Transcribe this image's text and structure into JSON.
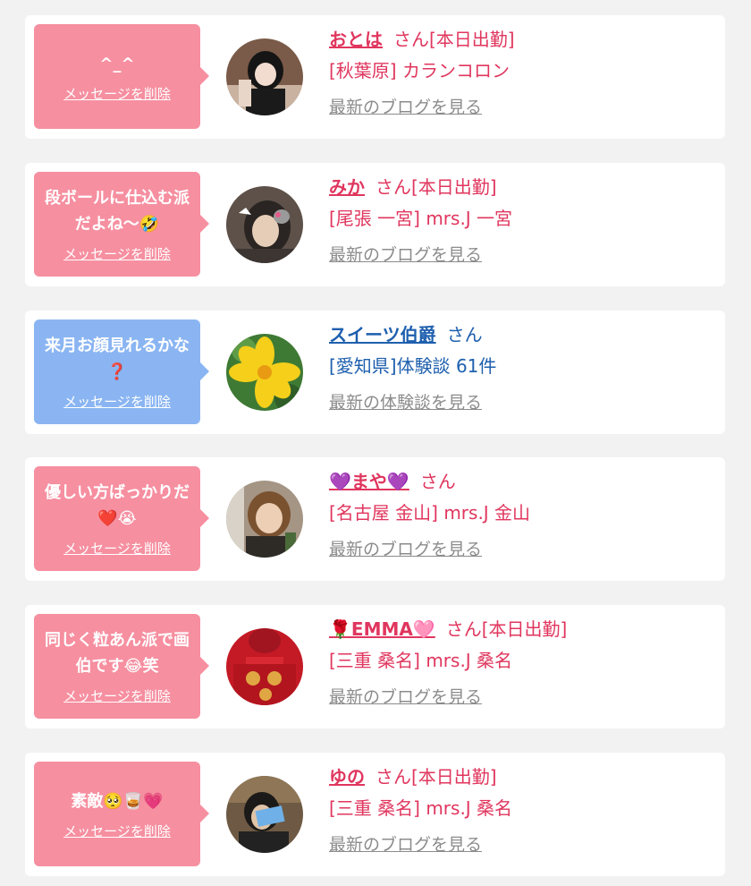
{
  "colors": {
    "pink_text": "#e0365e",
    "blue_text": "#1e5fae",
    "pink_bubble": "#f68fa0",
    "blue_bubble": "#8ab5f2",
    "link_gray": "#8c8c8c"
  },
  "items": [
    {
      "theme": "pink",
      "message": "^_^",
      "delete_label": "メッセージを削除",
      "name": "おとは",
      "honorific": "さん",
      "status": "[本日出勤]",
      "shop": "[秋葉原] カランコロン",
      "link": "最新のブログを見る"
    },
    {
      "theme": "pink",
      "message": "段ボールに仕込む派だよね〜🤣",
      "delete_label": "メッセージを削除",
      "name": "みか",
      "honorific": "さん",
      "status": "[本日出勤]",
      "shop": "[尾張 一宮] mrs.J 一宮",
      "link": "最新のブログを見る"
    },
    {
      "theme": "blue",
      "message": "来月お顔見れるかな❓",
      "delete_label": "メッセージを削除",
      "name": "スイーツ伯爵",
      "honorific": "さん",
      "status": "",
      "shop": "[愛知県]体験談 61件",
      "link": "最新の体験談を見る"
    },
    {
      "theme": "pink",
      "message": "優しい方ばっかりだ❤️😭",
      "delete_label": "メッセージを削除",
      "name": "💜まや💜",
      "honorific": "さん",
      "status": "",
      "shop": "[名古屋 金山] mrs.J 金山",
      "link": "最新のブログを見る"
    },
    {
      "theme": "pink",
      "message": "同じく粒あん派で画伯です😂笑",
      "delete_label": "メッセージを削除",
      "name": "🌹EMMA🩷",
      "honorific": "さん",
      "status": "[本日出勤]",
      "shop": "[三重 桑名] mrs.J 桑名",
      "link": "最新のブログを見る"
    },
    {
      "theme": "pink",
      "message": "素敵🥺🥃💗",
      "delete_label": "メッセージを削除",
      "name": "ゆの",
      "honorific": "さん",
      "status": "[本日出勤]",
      "shop": "[三重 桑名] mrs.J 桑名",
      "link": "最新のブログを見る"
    }
  ]
}
